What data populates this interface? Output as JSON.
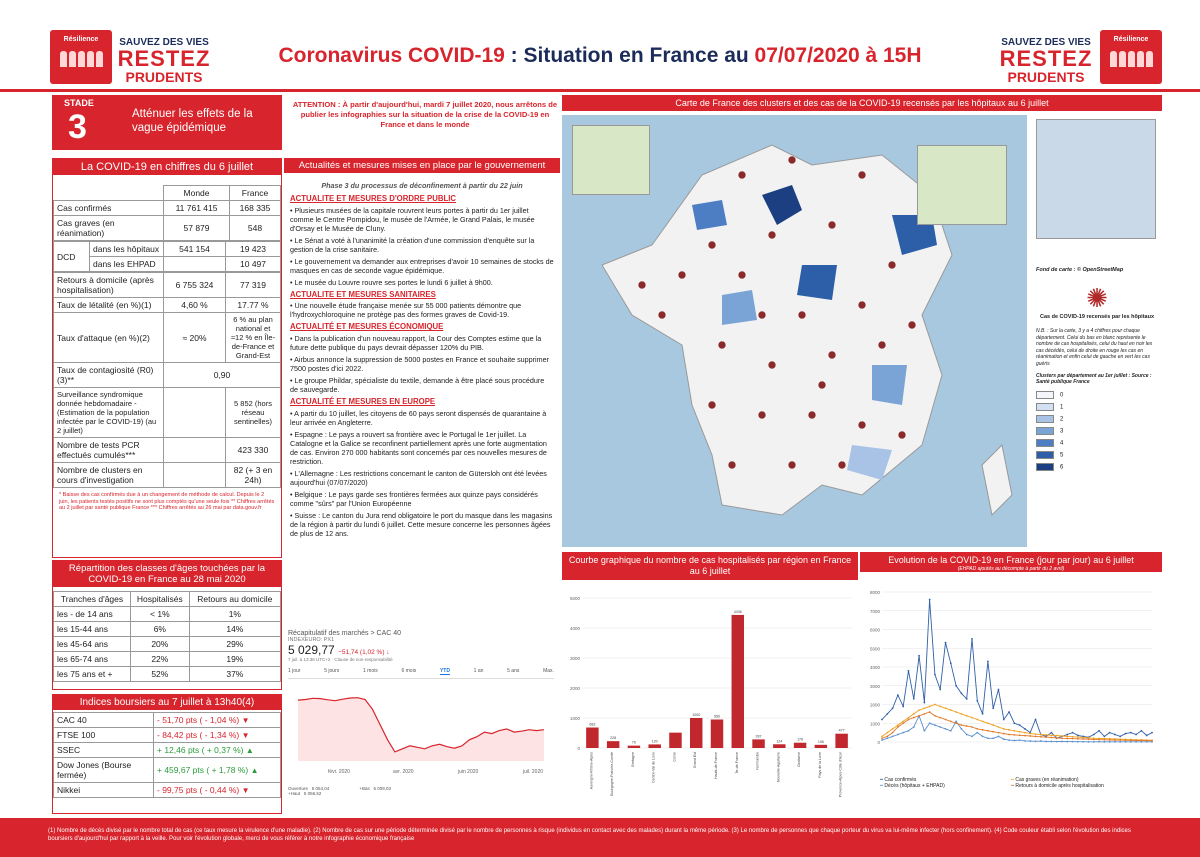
{
  "header": {
    "logo_text": "Résilience",
    "slogan_1": "SAUVEZ DES VIES",
    "slogan_2": "RESTEZ",
    "slogan_3": "PRUDENTS",
    "title_a": "Coronavirus COVID-19",
    "title_b": " : Situation en France au ",
    "title_c": "07/07/2020 à 15H"
  },
  "stade": {
    "label": "STADE",
    "num": "3",
    "text": "Atténuer les effets de la vague épidémique"
  },
  "attention": "ATTENTION : À partir d'aujourd'hui, mardi 7 juillet 2020, nous arrêtons de publier les infographies sur la situation de la crise de la COVID-19 en France et dans le monde",
  "chiffres": {
    "title": "La COVID-19 en chiffres du 6 juillet",
    "col_monde": "Monde",
    "col_france": "France",
    "rows": [
      {
        "label": "Cas confirmés",
        "monde": "11 761 415",
        "france": "168 335"
      },
      {
        "label": "Cas graves (en réanimation)",
        "monde": "57 879",
        "france": "548"
      }
    ],
    "dcd": "DCD",
    "dcd_hop": "dans les hôpitaux",
    "dcd_hop_m": "541 154",
    "dcd_hop_f": "19 423",
    "dcd_ehpad": "dans les EHPAD",
    "dcd_ehpad_f": "10 497",
    "rows2": [
      {
        "label": "Retours à domicile (après hospitalisation)",
        "monde": "6 755 324",
        "france": "77 319"
      },
      {
        "label": "Taux de létalité (en %)(1)",
        "monde": "4,60 %",
        "france": "17.77 %"
      },
      {
        "label": "Taux d'attaque (en %)(2)",
        "monde": "≈ 20%",
        "france": "6 % au plan national et ≈12 % en Île-de-France et Grand-Est"
      }
    ],
    "contag_label": "Taux de contagiosité (R0)(3)**",
    "contag_val": "0,90",
    "surv_label": "Surveillance syndromique donnée hebdomadaire - (Estimation de la population infectée par le COVID-19) (au 2 juillet)",
    "surv_val": "5 852 (hors réseau sentinelles)",
    "pcr_label": "Nombre de tests PCR effectués cumulés***",
    "pcr_val": "423 330",
    "clusters_label": "Nombre de clusters en cours d'investigation",
    "clusters_val": "82 (+ 3 en 24h)",
    "notes": "* Baisse des cas confirmés due à un changement de méthode de calcul. Depuis le 2 juin, les patients testés positifs ne sont plus comptés qu'une seule fois ** Chiffres arrêtés au 2 juillet par santé publique France *** Chiffres arrêtés au 26 mai par data.gouv.fr"
  },
  "ages": {
    "title": "Répartition des classes d'âges touchées par la COVID-19 en France au 28 mai 2020",
    "h1": "Tranches d'âges",
    "h2": "Hospitalisés",
    "h3": "Retours au domicile",
    "rows": [
      {
        "a": "les - de 14 ans",
        "h": "< 1%",
        "r": "1%"
      },
      {
        "a": "les 15-44 ans",
        "h": "6%",
        "r": "14%"
      },
      {
        "a": "les 45-64 ans",
        "h": "20%",
        "r": "29%"
      },
      {
        "a": "les 65-74 ans",
        "h": "22%",
        "r": "19%"
      },
      {
        "a": "les 75 ans et +",
        "h": "52%",
        "r": "37%"
      }
    ]
  },
  "bourse": {
    "title": "Indices boursiers au 7 juillet à 13h40(4)",
    "rows": [
      {
        "n": "CAC 40",
        "v": "- 51,70 pts ( - 1,04 %)",
        "dir": "down"
      },
      {
        "n": "FTSE 100",
        "v": "- 84,42 pts ( - 1,34 %)",
        "dir": "down"
      },
      {
        "n": "SSEC",
        "v": "+ 12,46 pts ( + 0,37 %)",
        "dir": "up"
      },
      {
        "n": "Dow Jones (Bourse fermée)",
        "v": "+ 459,67 pts ( + 1,78 %)",
        "dir": "up"
      },
      {
        "n": "Nikkei",
        "v": "- 99,75 pts ( - 0,44 %)",
        "dir": "down"
      }
    ]
  },
  "actus": {
    "title": "Actualités et mesures mises en place par le gouvernement",
    "phase": "Phase 3 du processus de déconfinement à partir du 22 juin",
    "sections": [
      {
        "h": "ACTUALITE ET MESURES D'ORDRE PUBLIC",
        "items": [
          "• Plusieurs musées de la capitale rouvrent leurs portes à partir du 1er juillet comme le Centre Pompidou, le musée de l'Armée, le Grand Palais, le musée d'Orsay et le Musée de Cluny.",
          "• Le Sénat a voté à l'unanimité la création d'une commission d'enquête sur la gestion de la crise sanitaire.",
          "• Le gouvernement va demander aux entreprises d'avoir 10 semaines de stocks de masques en cas de seconde vague épidémique.",
          "• Le musée du Louvre rouvre ses portes le lundi 6 juillet à 9h00."
        ]
      },
      {
        "h": "ACTUALITE ET MESURES SANITAIRES",
        "items": [
          "• Une nouvelle étude française menée sur 55 000 patients démontre que l'hydroxychloroquine ne protège pas des formes graves de Covid-19."
        ]
      },
      {
        "h": "ACTUALITÉ ET MESURES ÉCONOMIQUE",
        "items": [
          "• Dans la publication d'un nouveau rapport, la Cour des Comptes estime que la future dette publique du pays devrait dépasser 120% du PIB.",
          "• Airbus annonce la suppression de 5000 postes en France et souhaite supprimer 7500 postes d'ici 2022.",
          "• Le groupe Phildar, spécialiste du textile, demande à être placé sous procédure de sauvegarde."
        ]
      },
      {
        "h": "ACTUALITÉ ET MESURES EN EUROPE",
        "items": [
          "• A partir du 10 juillet, les citoyens de 60 pays seront dispensés de quarantaine à leur arrivée en Angleterre.",
          "• Espagne : Le pays a rouvert sa frontière avec le Portugal le 1er juillet. La Catalogne et la Galice se reconfinent partiellement après une forte augmentation de cas. Environ 270 000 habitants sont concernés par ces nouvelles mesures de restriction.",
          "• L'Allemagne : Les restrictions concernant le canton de Gütersloh ont été levées aujourd'hui (07/07/2020)",
          "• Belgique : Le pays garde ses frontières fermées aux quinze pays considérés comme \"sûrs\" par l'Union Européenne",
          "• Suisse : Le canton du Jura rend obligatoire le port du masque dans les magasins de la région à partir du lundi 6 juillet. Cette mesure concerne les personnes âgées de plus de 12 ans."
        ]
      }
    ]
  },
  "cac": {
    "crumb": "Récapitulatif des marchés > CAC 40",
    "sub": "INDEXEURO: PX1",
    "price": "5 029,77",
    "change": "−51,74 (1,02 %) ↓",
    "time": "7 juil. à 13:36 UTC+2 · Clause de non-responsabilité",
    "ranges": [
      "1 jour",
      "5 jours",
      "1 mois",
      "6 mois",
      "YTD",
      "1 an",
      "5 ans",
      "Max."
    ],
    "active_range": "YTD",
    "xticks": [
      "févr. 2020",
      "avr. 2020",
      "juin 2020",
      "juil. 2020"
    ],
    "f1k": "Ouverture",
    "f1v": "5 054,04",
    "f2k": "+Bas",
    "f2v": "5 009,03",
    "f3k": "+Haut",
    "f3v": "5 056,52",
    "series": [
      6000,
      6020,
      6060,
      6050,
      6010,
      5980,
      6030,
      6070,
      6080,
      6020,
      5700,
      5200,
      4700,
      4300,
      4400,
      4500,
      4450,
      4400,
      4500,
      4550,
      4470,
      4420,
      4500,
      4700,
      4800,
      4950,
      4900,
      5000,
      5050,
      4950,
      4980,
      5030,
      5000,
      5029
    ]
  },
  "map": {
    "title": "Carte de France des clusters et des cas de la COVID-19 recensés par les hôpitaux au 6 juillet",
    "fond": "Fond de carte : © OpenStreetMap",
    "virus_caption": "Cas de COVID-19 recensés par les hôpitaux",
    "nb": "N.B. : Sur la carte, 3 y a 4 chiffres pour chaque département. Celui du bas en blanc représente le nombre de cas hospitalisés, celui du haut en noir les cas décédés, celui de droite en rouge les cas en réanimation et enfin celui de gauche en vert les cas guéris",
    "clusters_src": "Clusters par département au 1er juillet : Source : Santé publique France",
    "legend": [
      "0",
      "1",
      "2",
      "3",
      "4",
      "5",
      "6"
    ],
    "legend_colors": [
      "#f4f6fb",
      "#d3e0f3",
      "#a9c3e6",
      "#7aa3d6",
      "#4d7ec4",
      "#2d5fa8",
      "#1b3f80"
    ],
    "labels": [
      "1",
      "2",
      "3",
      "4",
      "5",
      "6",
      "7",
      "8"
    ]
  },
  "hosp": {
    "title": "Courbe graphique du nombre de cas hospitalisés par région en France au 6 juillet"
  },
  "evol": {
    "title": "Evolution de la COVID-19 en France (jour par jour) au 6 juillet",
    "sub": "(EHPAD ajoutés au décompte à partir du 2 avril)",
    "legend": [
      "Cas confirmés",
      "Cas graves (en réanimation)",
      "Décès (hôpitaux + EHPAD)",
      "Retours à domicile après hospitalisation"
    ],
    "colors": [
      "#2f5fa8",
      "#f0a020",
      "#5b8fd0",
      "#e07a2a"
    ]
  },
  "footer": "(1) Nombre de décès divisé par le nombre total de cas (ce taux mesure la virulence d'une maladie). (2) Nombre de cas sur une période déterminée divisé par le nombre de personnes à risque (individus en contact avec des malades) durant la même période. (3) Le nombre de personnes que chaque porteur du virus va lui-même infecter (hors confinement). (4) Code couleur établi selon l'évolution des indices boursiers d'aujourd'hui par rapport à la veille. Pour voir l'évolution globale, merci de vous référer à notre infographie économique française",
  "chart_data": [
    {
      "type": "bar",
      "title": "Courbe graphique du nombre de cas hospitalisés par région en France au 6 juillet",
      "categories": [
        "Auvergne-Rhône-Alpes",
        "Bourgogne-Franche-Comté",
        "Bretagne",
        "Centre-Val de Loire",
        "Corse",
        "Grand Est",
        "Hauts-de-France",
        "Île-de-France",
        "Normandie",
        "Nouvelle-Aquitaine",
        "Occitanie",
        "Pays de la Loire",
        "Provence-Alpes-Côte d'Azur"
      ],
      "values": [
        683,
        228,
        79,
        120,
        512,
        1000,
        950,
        4436,
        287,
        124,
        176,
        106,
        477
      ],
      "labels": [
        "683",
        "228",
        "79",
        "120",
        "",
        "1000",
        "950",
        "4436",
        "287",
        "124",
        "176",
        "106",
        "477"
      ],
      "ylim": [
        0,
        5000
      ],
      "yticks": [
        "0",
        "1000",
        "2000",
        "3000",
        "4000",
        "5000"
      ]
    },
    {
      "type": "line",
      "title": "Evolution de la COVID-19 en France (jour par jour) au 6 juillet",
      "ylim": [
        0,
        8000
      ],
      "yticks": [
        "0",
        "1000",
        "2000",
        "3000",
        "4000",
        "5000",
        "6000",
        "7000",
        "8000"
      ],
      "series": [
        {
          "name": "Cas confirmés",
          "values": [
            1200,
            1500,
            1800,
            2500,
            1900,
            3800,
            2300,
            4600,
            2100,
            7600,
            3600,
            2800,
            5300,
            4200,
            3000,
            2600,
            2300,
            5500,
            2200,
            1500,
            4300,
            1800,
            2800,
            1200,
            1600,
            1000,
            900,
            700,
            500,
            1200,
            400,
            300,
            500,
            200,
            300,
            400,
            500,
            350,
            300,
            250,
            400,
            600,
            300,
            500,
            400,
            300,
            450,
            500,
            400,
            600,
            350,
            500
          ]
        },
        {
          "name": "Cas graves (en réanimation)",
          "values": [
            300,
            500,
            700,
            900,
            1100,
            1300,
            1500,
            1700,
            1800,
            1900,
            2000,
            1900,
            1800,
            1700,
            1600,
            1500,
            1400,
            1300,
            1200,
            1100,
            1000,
            900,
            800,
            700,
            650,
            600,
            550,
            500,
            450,
            420,
            400,
            380,
            360,
            340,
            320,
            300,
            280,
            260,
            240,
            220,
            200,
            190,
            180,
            170,
            160,
            150,
            140,
            130,
            120,
            110,
            100,
            90
          ]
        },
        {
          "name": "Décès (hôpitaux + EHPAD)",
          "values": [
            100,
            200,
            300,
            400,
            500,
            600,
            800,
            1400,
            600,
            1000,
            900,
            800,
            700,
            600,
            1100,
            700,
            400,
            300,
            500,
            300,
            200,
            200,
            300,
            150,
            100,
            80,
            100,
            60,
            50,
            40,
            50,
            30,
            30,
            20,
            30,
            20,
            20,
            15,
            15,
            10,
            10,
            15,
            10,
            10,
            10,
            10,
            10,
            10,
            10,
            10,
            10,
            10
          ]
        },
        {
          "name": "Retours à domicile après hospitalisation",
          "values": [
            200,
            300,
            500,
            800,
            1000,
            1200,
            1300,
            1400,
            1500,
            1600,
            1400,
            1300,
            1200,
            1100,
            1000,
            900,
            850,
            800,
            700,
            650,
            600,
            550,
            500,
            450,
            400,
            380,
            360,
            340,
            320,
            300,
            280,
            260,
            240,
            220,
            200,
            190,
            180,
            170,
            160,
            150,
            140,
            130,
            120,
            110,
            100,
            100,
            90,
            90,
            80,
            80,
            70,
            70
          ]
        }
      ]
    }
  ]
}
